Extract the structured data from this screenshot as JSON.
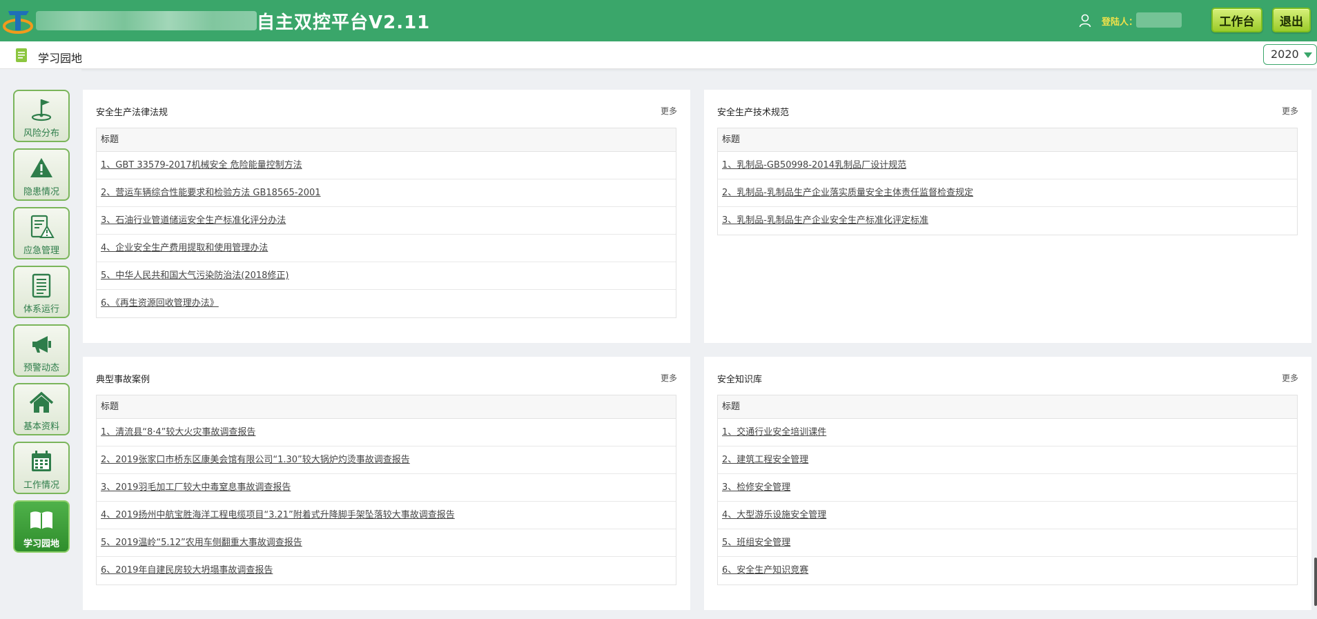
{
  "header": {
    "app_title": "自主双控平台V2.11",
    "login_label": "登陆人：",
    "work_button": "工作台",
    "exit_button": "退出"
  },
  "subheader": {
    "title": "学习园地",
    "year": "2020"
  },
  "sidebar": {
    "items": [
      {
        "label": "风险分布",
        "icon": "flag-icon"
      },
      {
        "label": "隐患情况",
        "icon": "warning-icon"
      },
      {
        "label": "应急管理",
        "icon": "emergency-doc-icon"
      },
      {
        "label": "体系运行",
        "icon": "document-icon"
      },
      {
        "label": "预警动态",
        "icon": "megaphone-icon"
      },
      {
        "label": "基本资料",
        "icon": "home-icon"
      },
      {
        "label": "工作情况",
        "icon": "calendar-icon"
      },
      {
        "label": "学习园地",
        "icon": "book-icon",
        "active": true
      }
    ]
  },
  "panels": {
    "laws": {
      "title": "安全生产法律法规",
      "more": "更多",
      "column": "标题",
      "rows": [
        "1、GBT 33579-2017机械安全 危险能量控制方法",
        "2、营运车辆综合性能要求和检验方法 GB18565-2001",
        "3、石油行业管道储运安全生产标准化评分办法",
        "4、企业安全生产费用提取和使用管理办法",
        "5、中华人民共和国大气污染防治法(2018修正)",
        "6、《再生资源回收管理办法》"
      ]
    },
    "tech": {
      "title": "安全生产技术规范",
      "more": "更多",
      "column": "标题",
      "rows": [
        "1、乳制品-GB50998-2014乳制品厂设计规范",
        "2、乳制品-乳制品生产企业落实质量安全主体责任监督检查规定",
        "3、乳制品-乳制品生产企业安全生产标准化评定标准"
      ]
    },
    "cases": {
      "title": "典型事故案例",
      "more": "更多",
      "column": "标题",
      "rows": [
        "1、清流县“8·4”较大火灾事故调查报告",
        "2、2019张家口市桥东区康美会馆有限公司“1.30”较大锅炉灼烫事故调查报告",
        "3、2019羽毛加工厂较大中毒窒息事故调查报告",
        "4、2019扬州中航宝胜海洋工程电缆项目“3.21”附着式升降脚手架坠落较大事故调查报告",
        "5、2019温岭“5.12”农用车侧翻重大事故调查报告",
        "6、2019年自建民房较大坍塌事故调查报告"
      ]
    },
    "knowledge": {
      "title": "安全知识库",
      "more": "更多",
      "column": "标题",
      "rows": [
        "1、交通行业安全培训课件",
        "2、建筑工程安全管理",
        "3、检修安全管理",
        "4、大型游乐设施安全管理",
        "5、班组安全管理",
        "6、安全生产知识竞赛"
      ]
    }
  },
  "colors": {
    "header_green": "#3aa66a",
    "login_yellow": "#f1e24a",
    "nav_border": "#7ab55a",
    "nav_active": "#3a9e36"
  }
}
